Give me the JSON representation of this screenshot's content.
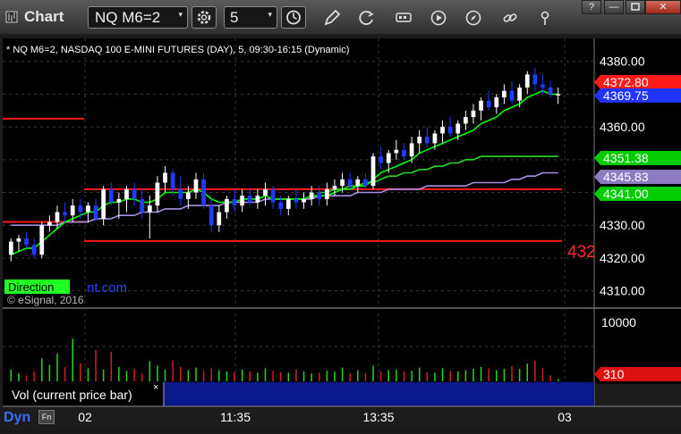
{
  "window": {
    "title": "Chart",
    "symbol": "NQ M6=2",
    "interval": "5",
    "buttons": [
      "clock",
      "pencil",
      "refresh",
      "settings",
      "play",
      "compass",
      "link",
      "pin"
    ],
    "controls": {
      "help": "?",
      "minimize": "—",
      "close": "✕"
    }
  },
  "chart_info": "* NQ M6=2, NASDAQ 100 E-MINI FUTURES (DAY), 5, 09:30-16:15 (Dynamic)",
  "watermark": "© eSignal, 2016",
  "direction_label": "Direction",
  "direction_url_tail": "nt.com",
  "red_level_label": "432",
  "volume_label": "Vol (current price bar)",
  "volume_close": "×",
  "volume_value": "310",
  "volume_axis_label": "10000",
  "footer": {
    "dyn": "Dyn",
    "dyn_icon": "Fn"
  },
  "colors": {
    "background": "#000000",
    "up_candle": "#ffffff",
    "down_candle": "#1e3cff",
    "fast_ma": "#00ff00",
    "mid_ma": "#22dd22",
    "slow_ma": "#a98ee6",
    "level": "#ff1a1a",
    "volume_up": "#1ed81e",
    "volume_down": "#d21e1e"
  },
  "chart_data": {
    "type": "candlestick",
    "ylim": [
      4305,
      4387
    ],
    "yticks": [
      4310.0,
      4320.0,
      4330.0,
      4340.0,
      4350.0,
      4360.0,
      4370.0,
      4380.0
    ],
    "xticks": [
      "02",
      "11:35",
      "13:35",
      "03"
    ],
    "price_tags": [
      {
        "value": "4372.80",
        "color": "#ff1a1a"
      },
      {
        "value": "4369.75",
        "color": "#2233ff"
      },
      {
        "value": "4351.38",
        "color": "#00cc00"
      },
      {
        "value": "4345.83",
        "color": "#8e7cc3"
      },
      {
        "value": "4341.00",
        "color": "#00cc00"
      }
    ],
    "candles": [
      [
        4321,
        4326,
        4319,
        4325
      ],
      [
        4325,
        4327,
        4322,
        4326
      ],
      [
        4326,
        4328,
        4323,
        4324
      ],
      [
        4324,
        4326,
        4320,
        4321
      ],
      [
        4321,
        4331,
        4320,
        4330
      ],
      [
        4330,
        4333,
        4328,
        4331
      ],
      [
        4331,
        4336,
        4329,
        4334
      ],
      [
        4334,
        4337,
        4331,
        4333
      ],
      [
        4333,
        4338,
        4331,
        4336
      ],
      [
        4336,
        4338,
        4332,
        4334
      ],
      [
        4334,
        4337,
        4331,
        4336
      ],
      [
        4336,
        4338,
        4331,
        4332
      ],
      [
        4332,
        4342,
        4330,
        4341
      ],
      [
        4341,
        4343,
        4336,
        4337
      ],
      [
        4337,
        4340,
        4332,
        4338
      ],
      [
        4338,
        4342,
        4334,
        4341
      ],
      [
        4341,
        4343,
        4336,
        4338
      ],
      [
        4338,
        4341,
        4332,
        4334
      ],
      [
        4334,
        4339,
        4326,
        4336
      ],
      [
        4336,
        4345,
        4334,
        4343
      ],
      [
        4343,
        4348,
        4340,
        4346
      ],
      [
        4346,
        4347,
        4339,
        4341
      ],
      [
        4341,
        4345,
        4336,
        4338
      ],
      [
        4338,
        4342,
        4335,
        4340
      ],
      [
        4340,
        4346,
        4338,
        4344
      ],
      [
        4344,
        4346,
        4335,
        4336
      ],
      [
        4336,
        4338,
        4328,
        4330
      ],
      [
        4330,
        4336,
        4328,
        4334
      ],
      [
        4334,
        4339,
        4332,
        4338
      ],
      [
        4338,
        4341,
        4334,
        4336
      ],
      [
        4336,
        4341,
        4334,
        4339
      ],
      [
        4339,
        4341,
        4336,
        4337
      ],
      [
        4337,
        4341,
        4335,
        4339
      ],
      [
        4339,
        4343,
        4336,
        4341
      ],
      [
        4341,
        4342,
        4335,
        4337
      ],
      [
        4337,
        4339,
        4333,
        4335
      ],
      [
        4335,
        4339,
        4333,
        4338
      ],
      [
        4338,
        4341,
        4335,
        4337
      ],
      [
        4337,
        4340,
        4335,
        4338
      ],
      [
        4338,
        4342,
        4336,
        4340
      ],
      [
        4340,
        4342,
        4336,
        4338
      ],
      [
        4338,
        4343,
        4336,
        4341
      ],
      [
        4341,
        4344,
        4339,
        4342
      ],
      [
        4342,
        4346,
        4340,
        4344
      ],
      [
        4344,
        4346,
        4341,
        4342
      ],
      [
        4342,
        4345,
        4340,
        4344
      ],
      [
        4344,
        4346,
        4341,
        4342
      ],
      [
        4342,
        4352,
        4341,
        4351
      ],
      [
        4351,
        4354,
        4347,
        4349
      ],
      [
        4349,
        4353,
        4346,
        4352
      ],
      [
        4352,
        4356,
        4350,
        4353
      ],
      [
        4353,
        4355,
        4350,
        4351
      ],
      [
        4351,
        4357,
        4349,
        4355
      ],
      [
        4355,
        4359,
        4352,
        4357
      ],
      [
        4357,
        4360,
        4354,
        4355
      ],
      [
        4355,
        4359,
        4353,
        4358
      ],
      [
        4358,
        4362,
        4355,
        4360
      ],
      [
        4360,
        4363,
        4357,
        4358
      ],
      [
        4358,
        4362,
        4356,
        4361
      ],
      [
        4361,
        4365,
        4359,
        4363
      ],
      [
        4363,
        4367,
        4361,
        4365
      ],
      [
        4365,
        4369,
        4362,
        4368
      ],
      [
        4368,
        4371,
        4365,
        4366
      ],
      [
        4366,
        4370,
        4364,
        4369
      ],
      [
        4369,
        4373,
        4367,
        4371
      ],
      [
        4371,
        4374,
        4367,
        4368
      ],
      [
        4368,
        4373,
        4366,
        4372
      ],
      [
        4372,
        4377,
        4370,
        4376
      ],
      [
        4376,
        4378,
        4371,
        4373
      ],
      [
        4373,
        4376,
        4370,
        4372
      ],
      [
        4372,
        4374,
        4369,
        4370
      ],
      [
        4370,
        4372,
        4367,
        4370
      ]
    ],
    "fast_ma": [
      4321,
      4322,
      4323,
      4323,
      4325,
      4327,
      4329,
      4331,
      4332,
      4333,
      4334,
      4334,
      4336,
      4337,
      4337,
      4338,
      4338,
      4337,
      4337,
      4338,
      4340,
      4340,
      4340,
      4340,
      4341,
      4340,
      4338,
      4337,
      4337,
      4337,
      4338,
      4338,
      4338,
      4339,
      4338,
      4338,
      4338,
      4338,
      4338,
      4339,
      4339,
      4339,
      4340,
      4341,
      4341,
      4342,
      4342,
      4344,
      4346,
      4347,
      4348,
      4349,
      4350,
      4352,
      4353,
      4354,
      4355,
      4356,
      4357,
      4358,
      4359,
      4361,
      4362,
      4363,
      4365,
      4366,
      4367,
      4369,
      4370,
      4371,
      4370,
      4370
    ],
    "mid_ma": [
      null,
      null,
      null,
      null,
      null,
      null,
      null,
      null,
      null,
      null,
      null,
      null,
      null,
      null,
      null,
      null,
      null,
      null,
      null,
      null,
      null,
      null,
      null,
      null,
      null,
      null,
      null,
      null,
      null,
      null,
      null,
      null,
      null,
      null,
      null,
      null,
      null,
      null,
      null,
      null,
      4340,
      4340,
      4341,
      4341,
      4342,
      4342,
      4343,
      4343,
      4344,
      4345,
      4345,
      4346,
      4346,
      4347,
      4347,
      4348,
      4348,
      4349,
      4349,
      4350,
      4350,
      4351,
      4351,
      4351,
      4351,
      4351,
      4351,
      4351,
      4351,
      4351,
      4351,
      4351
    ],
    "slow_ma": [
      4330,
      4330,
      4330,
      4330,
      4330,
      4330,
      4330,
      4331,
      4331,
      4331,
      4331,
      4332,
      4332,
      4332,
      4333,
      4333,
      4333,
      4334,
      4334,
      4334,
      4335,
      4335,
      4335,
      4336,
      4336,
      4336,
      4336,
      4336,
      4337,
      4337,
      4337,
      4337,
      4337,
      4338,
      4338,
      4338,
      4338,
      4338,
      4338,
      4338,
      4339,
      4339,
      4339,
      4339,
      4339,
      4340,
      4340,
      4340,
      4340,
      4341,
      4341,
      4341,
      4341,
      4341,
      4342,
      4342,
      4342,
      4342,
      4342,
      4342,
      4343,
      4343,
      4343,
      4343,
      4343,
      4344,
      4344,
      4345,
      4345,
      4346,
      4346,
      4346
    ],
    "levels": [
      {
        "value": 4362.5,
        "from": 0,
        "to": 10
      },
      {
        "value": 4341.0,
        "from": 10,
        "to": 72
      },
      {
        "value": 4331.0,
        "from": 0,
        "to": 10
      },
      {
        "value": 4325.2,
        "from": 10,
        "to": 72
      }
    ],
    "volume_ylim": [
      0,
      10500
    ],
    "volume": [
      1800,
      1200,
      900,
      1500,
      3500,
      2500,
      4200,
      2200,
      6500,
      2800,
      2000,
      4800,
      1800,
      4500,
      2200,
      1600,
      1900,
      1200,
      3100,
      2400,
      1800,
      3200,
      2200,
      1700,
      2100,
      1600,
      2000,
      1700,
      1500,
      1400,
      1800,
      1500,
      1300,
      2000,
      1600,
      1400,
      1300,
      1800,
      1500,
      1200,
      1300,
      1600,
      1500,
      2100,
      1200,
      1700,
      1300,
      2400,
      1500,
      1700,
      1800,
      1500,
      1600,
      2100,
      1400,
      1300,
      2000,
      1600,
      1500,
      1700,
      1900,
      2200,
      2000,
      1700,
      1900,
      2300,
      1900,
      2700,
      3200,
      2000,
      900,
      310
    ]
  }
}
